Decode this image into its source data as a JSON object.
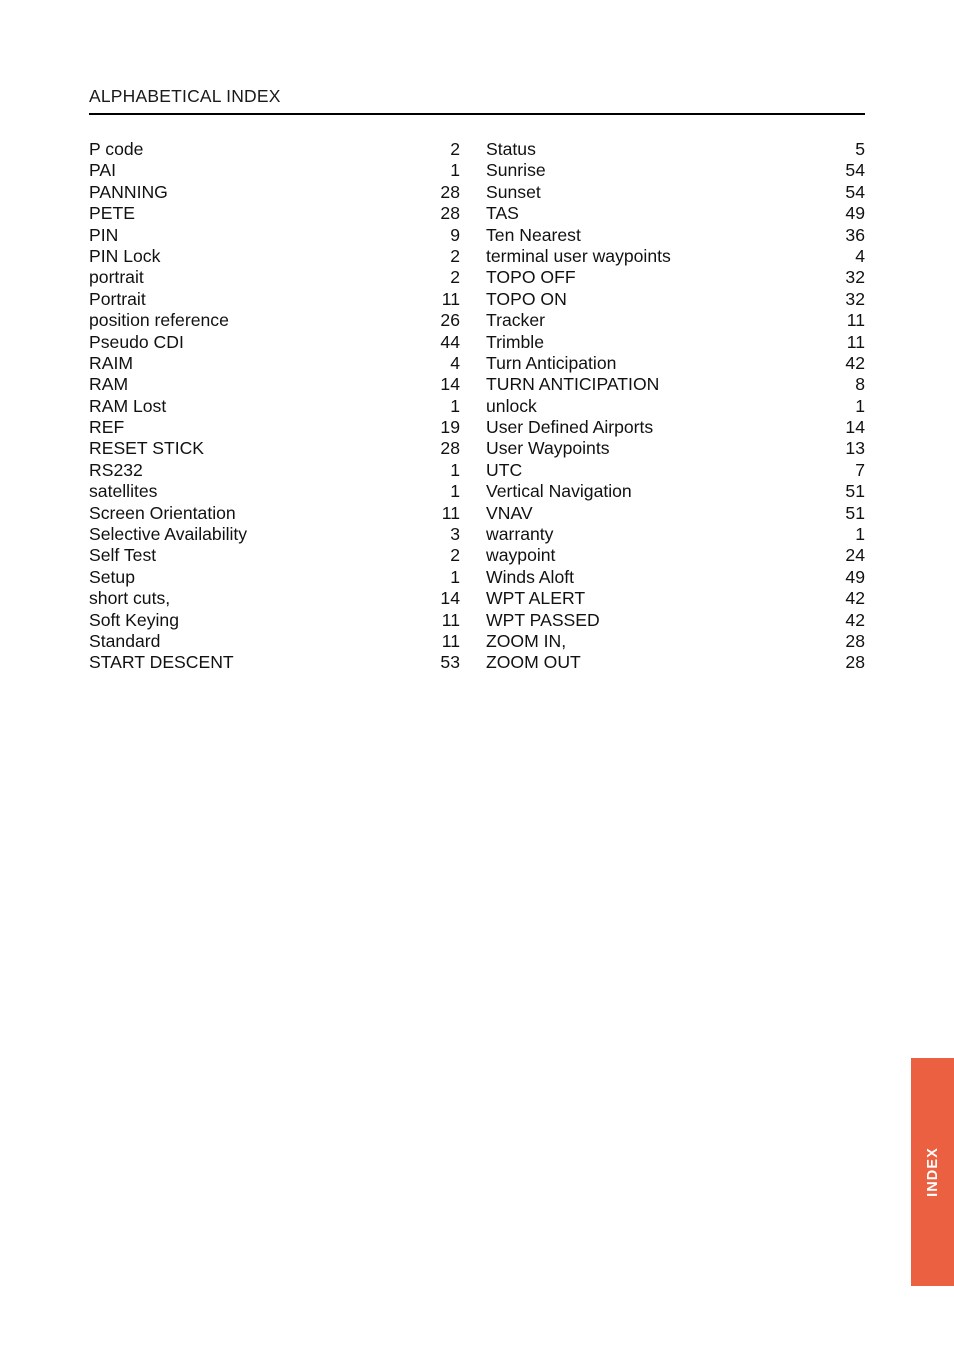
{
  "header": {
    "title": "ALPHABETICAL INDEX"
  },
  "side_tab": {
    "label": "INDEX",
    "color": "#ea6040",
    "text_color": "#ffffff"
  },
  "index": {
    "columns": [
      {
        "entries": [
          {
            "term": "P code",
            "page": "2"
          },
          {
            "term": "PAI",
            "page": "1"
          },
          {
            "term": "PANNING",
            "page": "28"
          },
          {
            "term": "PETE",
            "page": "28"
          },
          {
            "term": "PIN",
            "page": "9"
          },
          {
            "term": "PIN Lock",
            "page": "2"
          },
          {
            "term": "portrait",
            "page": "2"
          },
          {
            "term": "Portrait",
            "page": "11"
          },
          {
            "term": "position reference",
            "page": "26"
          },
          {
            "term": "Pseudo CDI",
            "page": "44"
          },
          {
            "term": "RAIM",
            "page": "4"
          },
          {
            "term": "RAM",
            "page": "14"
          },
          {
            "term": "RAM Lost",
            "page": "1"
          },
          {
            "term": "REF",
            "page": "19"
          },
          {
            "term": "RESET STICK",
            "page": "28"
          },
          {
            "term": "RS232",
            "page": "1"
          },
          {
            "term": "satellites",
            "page": "1"
          },
          {
            "term": "Screen Orientation",
            "page": "11"
          },
          {
            "term": "Selective Availability",
            "page": "3"
          },
          {
            "term": "Self Test",
            "page": "2"
          },
          {
            "term": "Setup",
            "page": "1"
          },
          {
            "term": "short cuts,",
            "page": "14"
          },
          {
            "term": "Soft Keying",
            "page": "11"
          },
          {
            "term": "Standard",
            "page": "11"
          },
          {
            "term": "START DESCENT",
            "page": "53"
          }
        ]
      },
      {
        "entries": [
          {
            "term": "Status",
            "page": "5"
          },
          {
            "term": "Sunrise",
            "page": "54"
          },
          {
            "term": "Sunset",
            "page": "54"
          },
          {
            "term": "TAS",
            "page": "49"
          },
          {
            "term": "Ten Nearest",
            "page": "36"
          },
          {
            "term": "terminal user waypoints",
            "page": "4"
          },
          {
            "term": "TOPO OFF",
            "page": "32"
          },
          {
            "term": "TOPO ON",
            "page": "32"
          },
          {
            "term": "Tracker",
            "page": "11"
          },
          {
            "term": "Trimble",
            "page": "11"
          },
          {
            "term": "Turn Anticipation",
            "page": "42"
          },
          {
            "term": "TURN ANTICIPATION",
            "page": "8"
          },
          {
            "term": "unlock",
            "page": "1"
          },
          {
            "term": "User Defined Airports",
            "page": "14"
          },
          {
            "term": "User Waypoints",
            "page": "13"
          },
          {
            "term": "UTC",
            "page": "7"
          },
          {
            "term": "Vertical Navigation",
            "page": "51"
          },
          {
            "term": "VNAV",
            "page": "51"
          },
          {
            "term": "warranty",
            "page": "1"
          },
          {
            "term": "waypoint",
            "page": "24"
          },
          {
            "term": "Winds Aloft",
            "page": "49"
          },
          {
            "term": "WPT ALERT",
            "page": "42"
          },
          {
            "term": "WPT PASSED",
            "page": "42"
          },
          {
            "term": "ZOOM IN,",
            "page": "28"
          },
          {
            "term": "ZOOM OUT",
            "page": "28"
          }
        ]
      }
    ]
  }
}
